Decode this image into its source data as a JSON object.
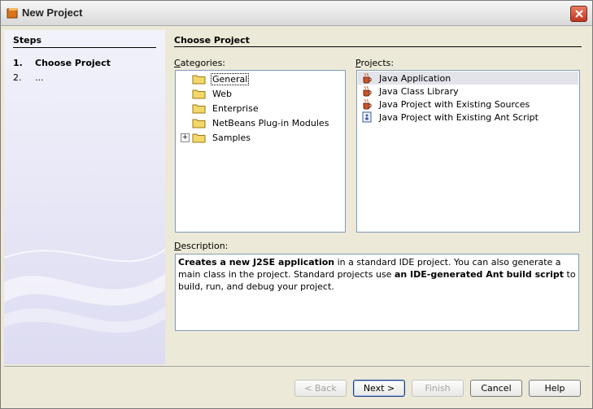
{
  "window": {
    "title": "New Project"
  },
  "steps": {
    "heading": "Steps",
    "items": [
      {
        "num": "1.",
        "label": "Choose Project"
      },
      {
        "num": "2.",
        "label": "..."
      }
    ]
  },
  "main": {
    "heading": "Choose Project",
    "categories_label": "Categories:",
    "categories_mnemonic": "C",
    "categories_rest": "ategories:",
    "projects_label": "Projects:",
    "projects_mnemonic": "P",
    "projects_rest": "rojects:",
    "categories": [
      {
        "label": "General",
        "selected": true
      },
      {
        "label": "Web"
      },
      {
        "label": "Enterprise"
      },
      {
        "label": "NetBeans Plug-in Modules"
      },
      {
        "label": "Samples",
        "expandable": true
      }
    ],
    "projects": [
      {
        "label": "Java Application",
        "icon": "java-cup-icon",
        "selected": true
      },
      {
        "label": "Java Class Library",
        "icon": "java-cup-icon"
      },
      {
        "label": "Java Project with Existing Sources",
        "icon": "java-cup-icon"
      },
      {
        "label": "Java Project with Existing Ant Script",
        "icon": "ant-script-icon"
      }
    ],
    "description_label": "Description:",
    "description_mnemonic": "D",
    "description_rest": "escription:",
    "description": {
      "p1_bold": "Creates a new J2SE application",
      "p1": " in a standard IDE project. You can also generate a main class in the project. Standard projects use ",
      "p2_bold": "an IDE-generated Ant build script",
      "p2": " to build, run, and debug your project."
    }
  },
  "buttons": {
    "back": "< Back",
    "next": "Next >",
    "finish": "Finish",
    "cancel": "Cancel",
    "help": "Help"
  }
}
